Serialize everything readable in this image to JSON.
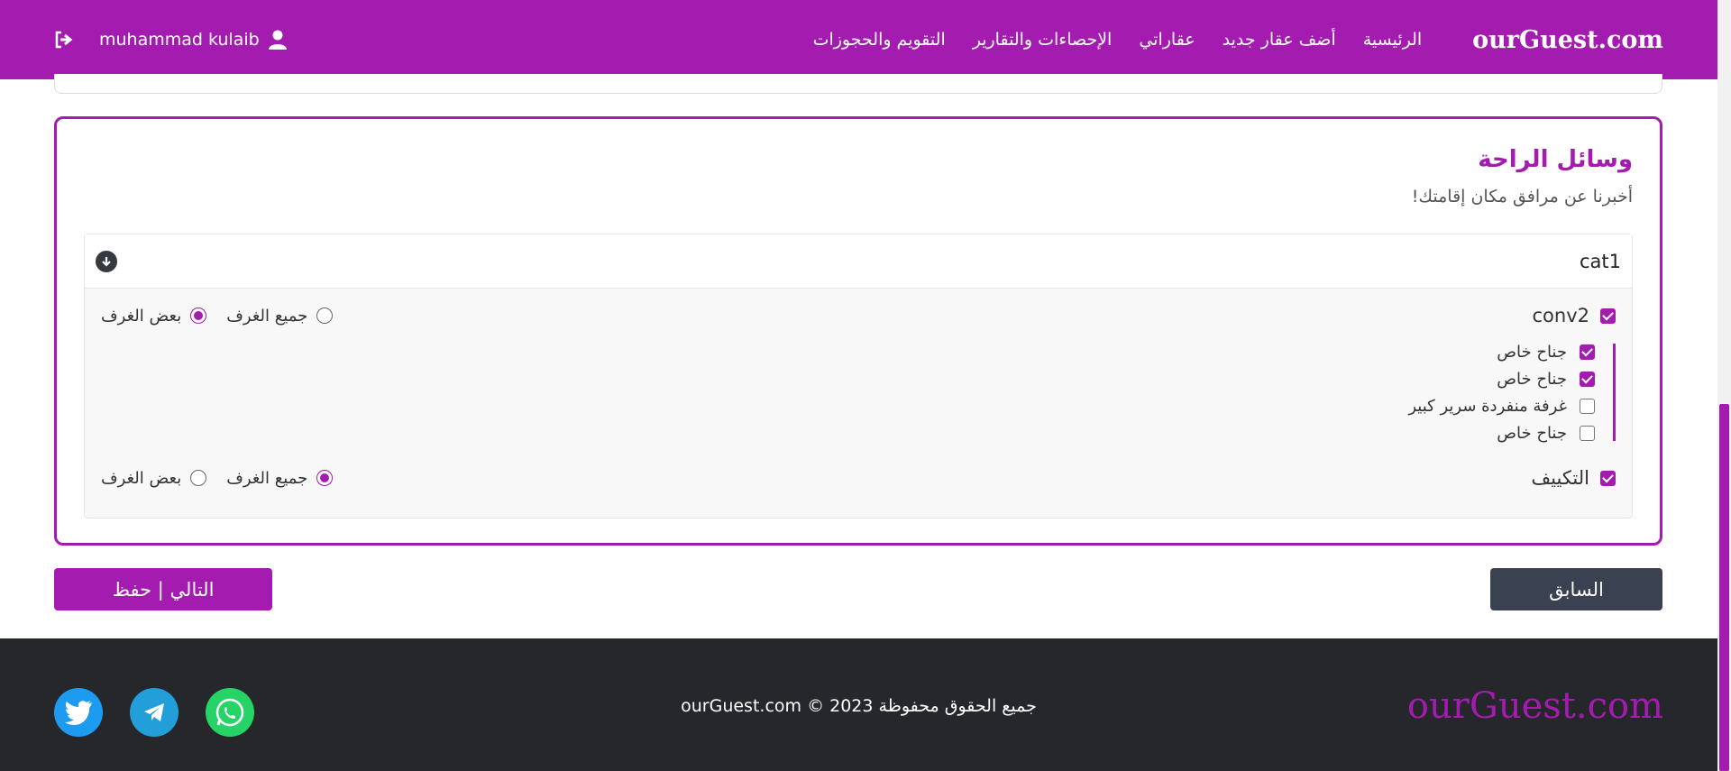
{
  "header": {
    "brand": "ourGuest.com",
    "nav": [
      "الرئيسية",
      "أضف عقار جديد",
      "عقاراتي",
      "الإحصاءات والتقارير",
      "التقويم والحجوزات"
    ],
    "user_name": "muhammad kulaib",
    "icons": {
      "user": "user-icon",
      "logout": "logout-icon"
    }
  },
  "amenities": {
    "title": "وسائل الراحة",
    "subtitle": "أخبرنا عن مرافق مكان إقامتك!",
    "category": {
      "name": "cat1",
      "items": [
        {
          "label": "conv2",
          "checked": true,
          "radio_all": "جميع الغرف",
          "radio_some": "بعض الغرف",
          "selected": "some",
          "rooms": [
            {
              "label": "جناح خاص",
              "checked": true
            },
            {
              "label": "جناح خاص",
              "checked": true
            },
            {
              "label": "غرفة منفردة سرير كبير",
              "checked": false
            },
            {
              "label": "جناح خاص",
              "checked": false
            }
          ]
        },
        {
          "label": "التكييف",
          "checked": true,
          "radio_all": "جميع الغرف",
          "radio_some": "بعض الغرف",
          "selected": "all"
        }
      ]
    }
  },
  "buttons": {
    "prev": "السابق",
    "next": "التالي | حفظ"
  },
  "footer": {
    "brand": "ourGuest.com",
    "copyright": "جميع الحقوق محفوظة 2023 © ourGuest.com",
    "social": [
      "whatsapp-icon",
      "telegram-icon",
      "twitter-icon"
    ]
  },
  "colors": {
    "accent": "#a41bb0",
    "dark": "#26272b",
    "button_dark": "#3a4150"
  }
}
